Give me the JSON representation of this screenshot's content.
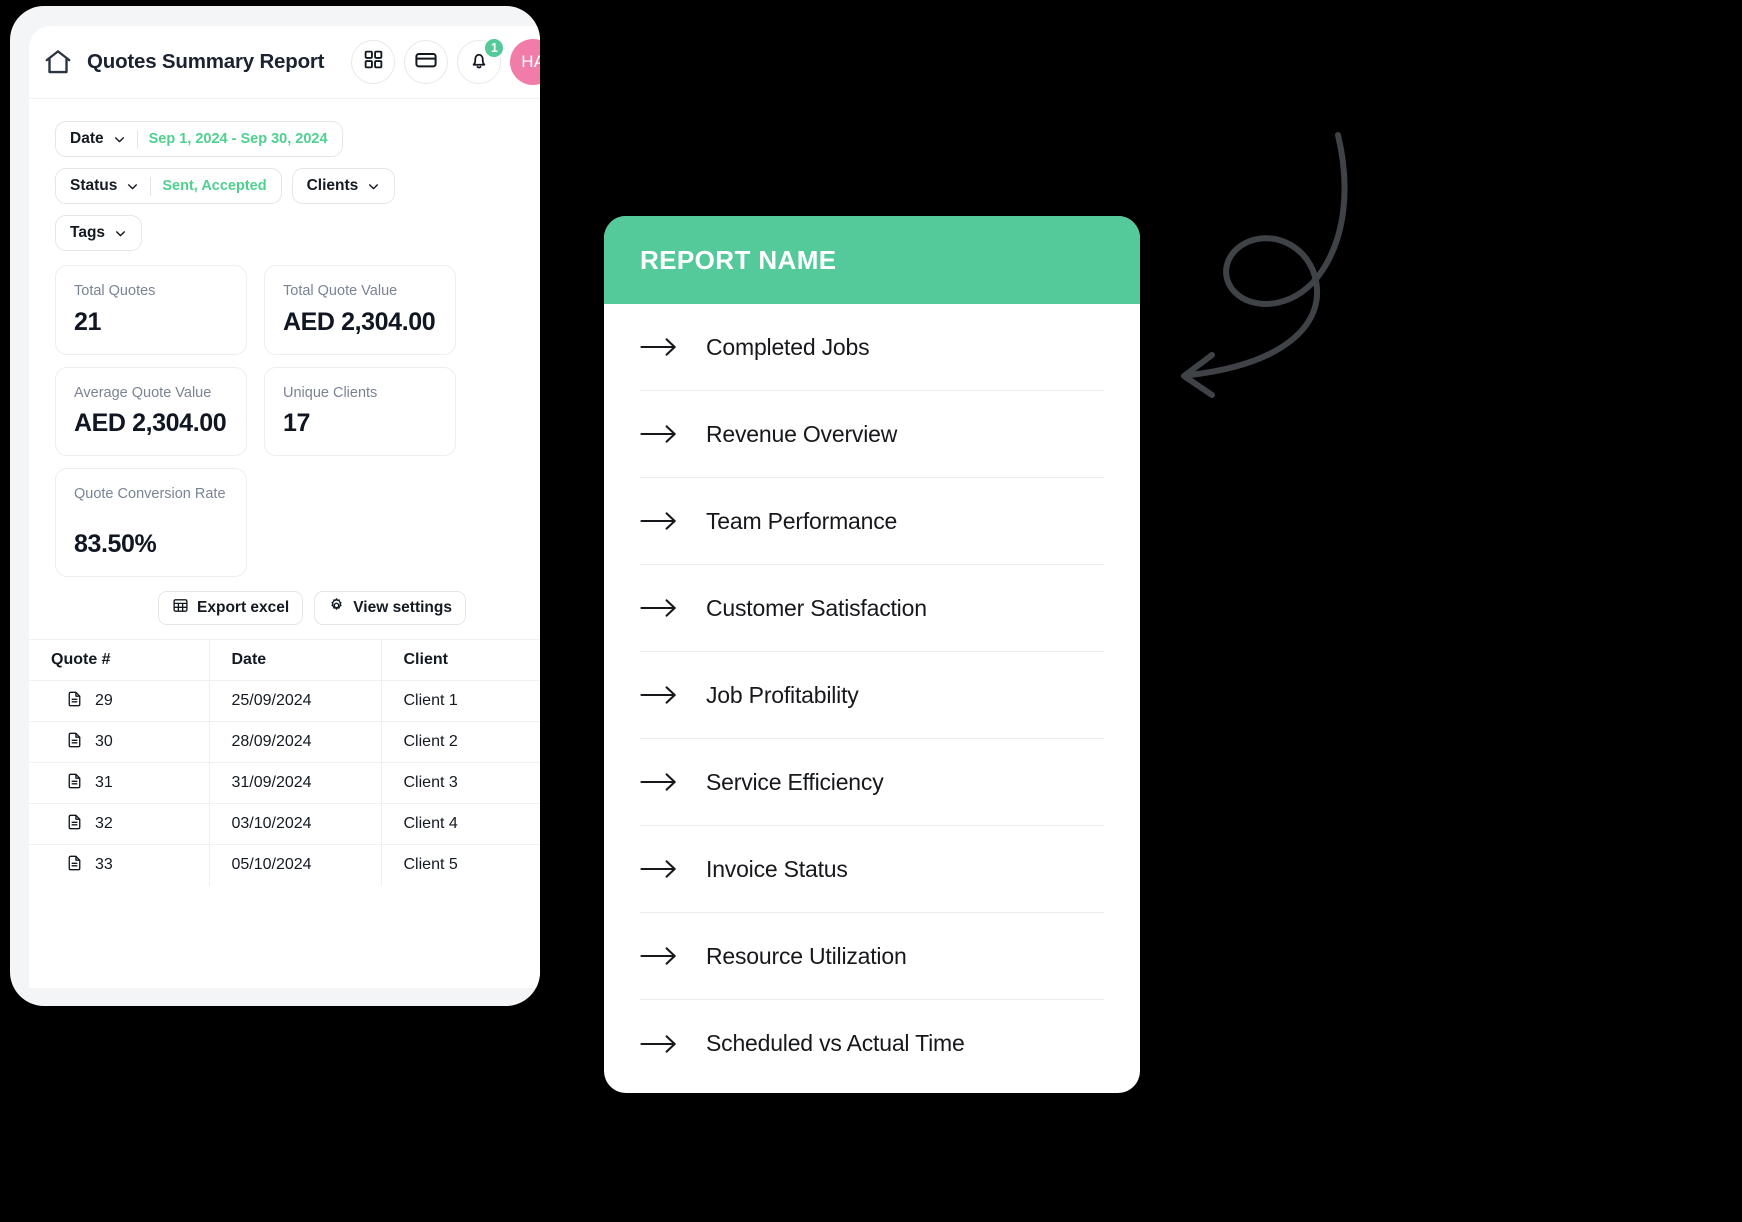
{
  "app": {
    "title": "Quotes Summary Report",
    "home_icon": "home-icon",
    "actions": [
      {
        "name": "grid-icon",
        "label": ""
      },
      {
        "name": "card-icon",
        "label": ""
      },
      {
        "name": "bell-icon",
        "label": ""
      }
    ],
    "notification_count": "1",
    "avatar_initials": "HA",
    "avatar_color": "#f17ca9",
    "accent_color": "#54c99a"
  },
  "filters": {
    "date": {
      "label": "Date",
      "value": "Sep 1, 2024 - Sep 30, 2024"
    },
    "status": {
      "label": "Status",
      "value": "Sent, Accepted"
    },
    "clients": {
      "label": "Clients",
      "value": ""
    },
    "tags": {
      "label": "Tags",
      "value": ""
    }
  },
  "stats": [
    {
      "label": "Total Quotes",
      "value": "21"
    },
    {
      "label": "Total Quote Value",
      "value": "AED 2,304.00"
    },
    {
      "label": "Average Quote Value",
      "value": "AED 2,304.00"
    },
    {
      "label": "Unique Clients",
      "value": "17"
    },
    {
      "label": "Quote Conversion Rate",
      "value": "83.50%"
    }
  ],
  "toolbar": {
    "export_label": "Export excel",
    "settings_label": "View settings"
  },
  "table": {
    "columns": [
      "Quote #",
      "Date",
      "Client"
    ],
    "rows": [
      {
        "quote": "29",
        "date": "25/09/2024",
        "client": "Client 1"
      },
      {
        "quote": "30",
        "date": "28/09/2024",
        "client": "Client 2"
      },
      {
        "quote": "31",
        "date": "31/09/2024",
        "client": "Client 3"
      },
      {
        "quote": "32",
        "date": "03/10/2024",
        "client": "Client 4"
      },
      {
        "quote": "33",
        "date": "05/10/2024",
        "client": "Client 5"
      }
    ]
  },
  "report_panel": {
    "title": "REPORT NAME",
    "header_color": "#54c99a",
    "items": [
      {
        "label": "Completed Jobs"
      },
      {
        "label": "Revenue Overview"
      },
      {
        "label": "Team Performance"
      },
      {
        "label": "Customer Satisfaction"
      },
      {
        "label": "Job Profitability"
      },
      {
        "label": "Service Efficiency"
      },
      {
        "label": "Invoice Status"
      },
      {
        "label": "Resource Utilization"
      },
      {
        "label": "Scheduled vs Actual Time"
      }
    ]
  },
  "decoration": {
    "squiggle_arrow_color": "#3f4246"
  }
}
